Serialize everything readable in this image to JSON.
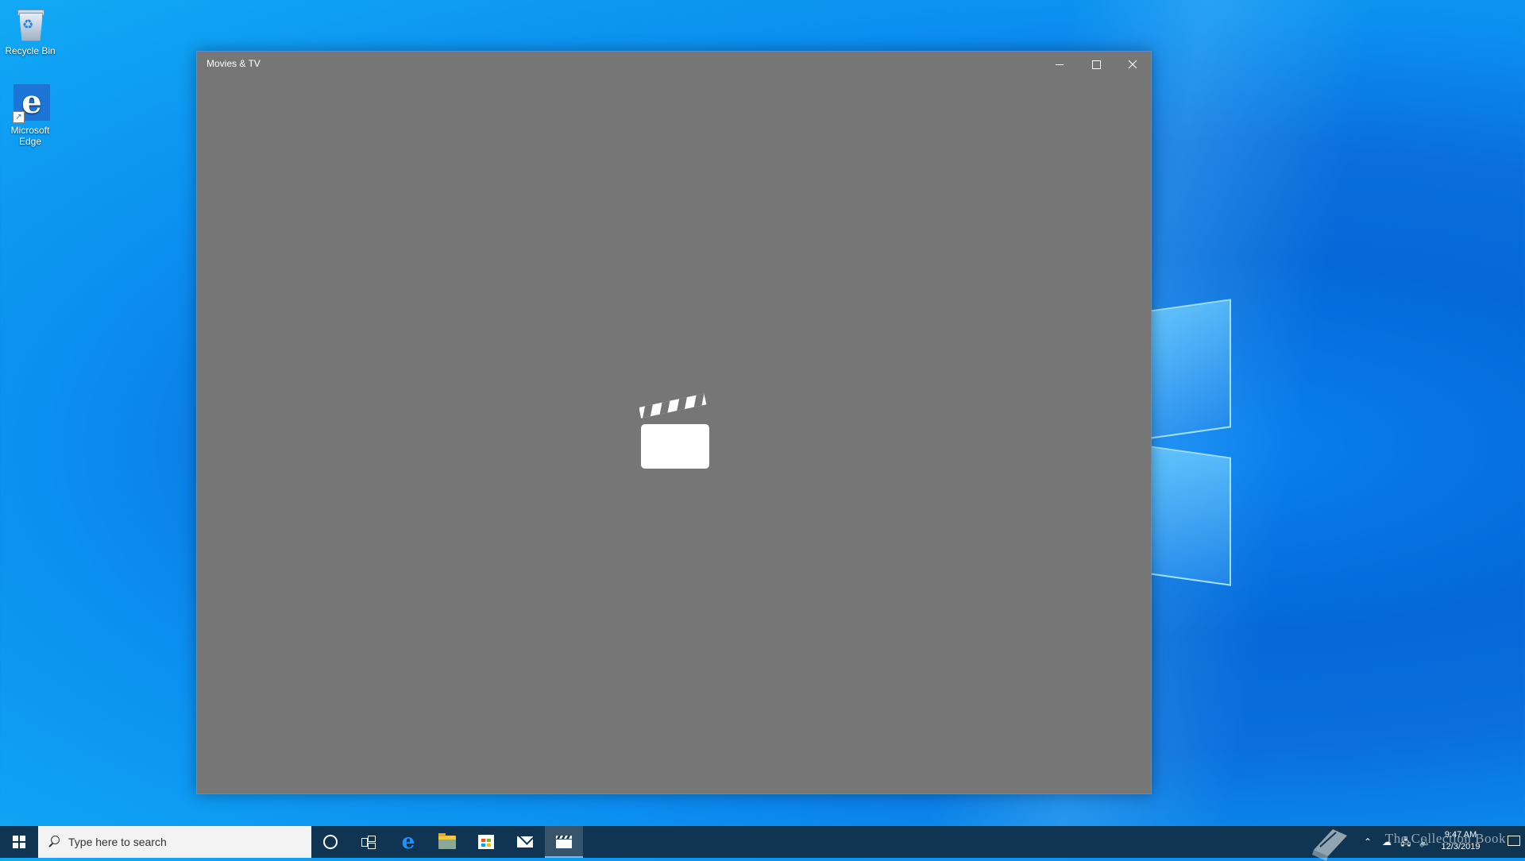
{
  "desktop": {
    "icons": [
      {
        "label": "Recycle Bin",
        "icon": "recycle-bin-icon"
      },
      {
        "label": "Microsoft Edge",
        "icon": "edge-icon"
      }
    ]
  },
  "window": {
    "title": "Movies & TV",
    "background": "#767676",
    "splash_icon": "clapperboard-icon",
    "controls": {
      "minimize": "minimize",
      "maximize": "maximize",
      "close": "close"
    }
  },
  "taskbar": {
    "search_placeholder": "Type here to search",
    "apps": [
      {
        "name": "Cortana",
        "icon": "cortana-icon"
      },
      {
        "name": "Task View",
        "icon": "task-view-icon"
      },
      {
        "name": "Microsoft Edge",
        "icon": "edge-icon"
      },
      {
        "name": "File Explorer",
        "icon": "folder-icon"
      },
      {
        "name": "Microsoft Store",
        "icon": "store-icon"
      },
      {
        "name": "Mail",
        "icon": "mail-icon"
      },
      {
        "name": "Movies & TV",
        "icon": "clapperboard-icon",
        "active": true
      }
    ],
    "tray": {
      "time": "9:47 AM",
      "date": "12/3/2019",
      "icons": [
        "show-hidden-icon",
        "onedrive-icon",
        "network-icon",
        "volume-icon",
        "notifications-icon"
      ]
    }
  },
  "watermark": {
    "text": "The Collection Book"
  },
  "colors": {
    "taskbar": "#103552",
    "accent": "#1b74d6",
    "window_bg": "#767676"
  }
}
